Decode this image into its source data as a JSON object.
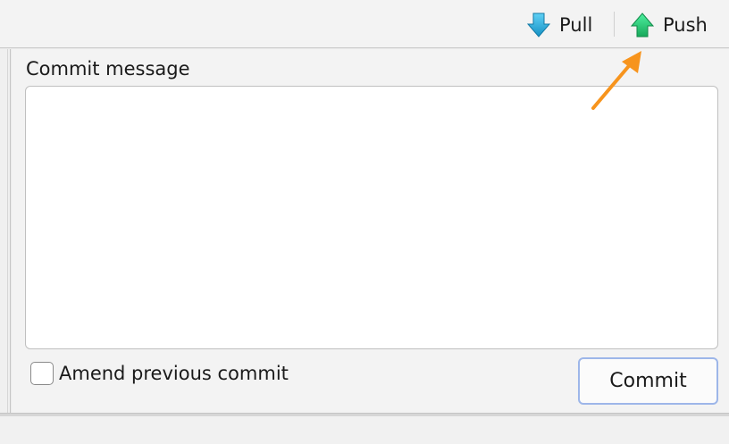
{
  "toolbar": {
    "pull_label": "Pull",
    "push_label": "Push",
    "pull_icon": "arrow-down-icon",
    "push_icon": "arrow-up-icon"
  },
  "commit_panel": {
    "message_label": "Commit message",
    "message_value": "",
    "amend_label": "Amend previous commit",
    "amend_checked": false,
    "commit_label": "Commit"
  },
  "annotation": {
    "arrow_color": "#f7941d",
    "target": "push-button"
  },
  "colors": {
    "pull_icon": "#1ea7d6",
    "push_icon": "#2ecc71",
    "focus_ring": "#9db6e9"
  }
}
